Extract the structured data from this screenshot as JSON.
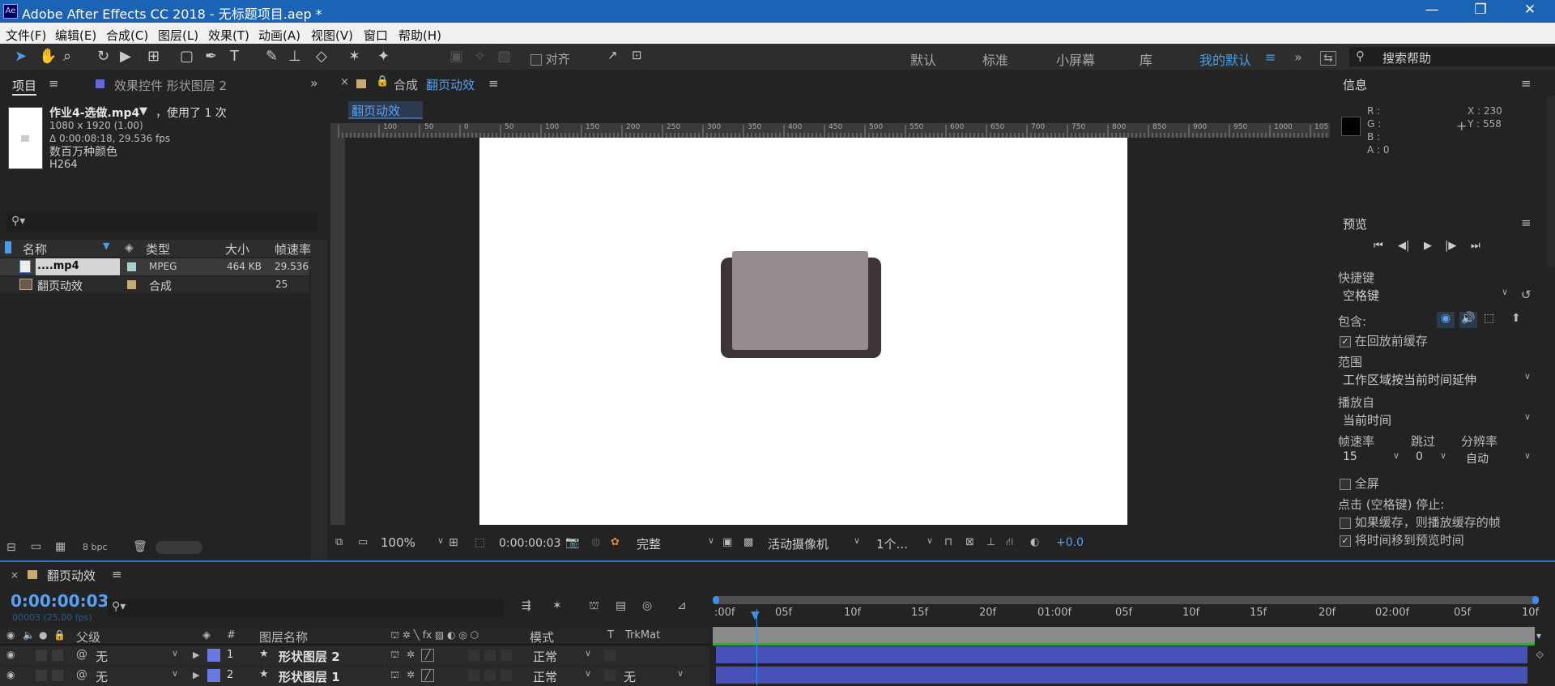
{
  "app": {
    "title": "Adobe After Effects CC 2018 - 无标题项目.aep *",
    "logo": "Ae"
  },
  "menu": [
    "文件(F)",
    "编辑(E)",
    "合成(C)",
    "图层(L)",
    "效果(T)",
    "动画(A)",
    "视图(V)",
    "窗口",
    "帮助(H)"
  ],
  "toolbar": {
    "align_label": "对齐",
    "workspaces": [
      "默认",
      "标准",
      "小屏幕",
      "库",
      "我的默认"
    ],
    "search_placeholder": "搜索帮助"
  },
  "project_panel": {
    "tab_project": "项目",
    "tab_effects": "效果控件 形状图层 2",
    "file_name": "作业4-选做.mp4",
    "used_text": "，使用了 1 次",
    "dims": "1080 x 1920 (1.00)",
    "duration": "Δ 0:00:08:18, 29.536 fps",
    "colors": "数百万种颜色",
    "codec": "H264",
    "columns": {
      "name": "名称",
      "type": "类型",
      "size": "大小",
      "fps": "帧速率"
    },
    "items": [
      {
        "name": "....mp4",
        "type": "MPEG",
        "size": "464 KB",
        "fps": "29.536",
        "color": "#a8d0d0"
      },
      {
        "name": "翻页动效",
        "type": "合成",
        "size": "",
        "fps": "25",
        "color": "#c6a973"
      }
    ],
    "bpc": "8 bpc"
  },
  "comp_panel": {
    "tab_prefix": "合成",
    "tab_name": "翻页动效",
    "sub_tab": "翻页动效",
    "ruler_ticks": [
      "100",
      "50",
      "0",
      "50",
      "100",
      "150",
      "200",
      "250",
      "300",
      "350",
      "400",
      "450",
      "500",
      "550",
      "600",
      "650",
      "700",
      "750",
      "800",
      "850",
      "900",
      "950",
      "1000",
      "105"
    ],
    "zoom": "100%",
    "timecode": "0:00:00:03",
    "quality": "完整",
    "camera": "活动摄像机",
    "views": "1个...",
    "exposure": "+0.0",
    "colors": {
      "card_back": "#3c3438",
      "card_front": "#958c91"
    }
  },
  "info_panel": {
    "title": "信息",
    "r": "R :",
    "g": "G :",
    "b": "B :",
    "a": "A : 0",
    "x": "X : 230",
    "y": "Y : 558"
  },
  "preview_panel": {
    "title": "预览",
    "shortcut_label": "快捷键",
    "shortcut_value": "空格键",
    "include_label": "包含:",
    "cache_before": "在回放前缓存",
    "range_label": "范围",
    "range_value": "工作区域按当前时间延伸",
    "play_from_label": "播放自",
    "play_from_value": "当前时间",
    "fps_label": "帧速率",
    "skip_label": "跳过",
    "res_label": "分辨率",
    "fps_value": "15",
    "skip_value": "0",
    "res_value": "自动",
    "fullscreen": "全屏",
    "stop_label": "点击 (空格键) 停止:",
    "if_cached": "如果缓存，则播放缓存的帧",
    "move_time": "将时间移到预览时间"
  },
  "timeline": {
    "tab_name": "翻页动效",
    "timecode": "0:00:00:03",
    "sub_timecode": "00003 (25.00 fps)",
    "col_parent": "父级",
    "col_num": "#",
    "col_layer": "图层名称",
    "col_mode": "模式",
    "col_t": "T",
    "col_trkmat": "TrkMat",
    "ruler": [
      ":00f",
      "05f",
      "10f",
      "15f",
      "20f",
      "01:00f",
      "05f",
      "10f",
      "15f",
      "20f",
      "02:00f",
      "05f",
      "10f"
    ],
    "layers": [
      {
        "num": "1",
        "name": "形状图层 2",
        "parent": "无",
        "mode": "正常",
        "trkmat": ""
      },
      {
        "num": "2",
        "name": "形状图层 1",
        "parent": "无",
        "mode": "正常",
        "trkmat": "无"
      }
    ],
    "playhead_frame": 3
  }
}
